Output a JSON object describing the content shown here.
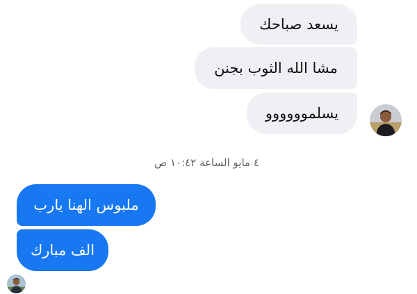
{
  "conversation": {
    "incoming": [
      {
        "text": "يسعد صباحك"
      },
      {
        "text": "مشا الله الثوب بجنن"
      },
      {
        "text": "يسلموووووو"
      }
    ],
    "timestamp": "٤ مايو الساعة ١٠:٤٢ ص",
    "outgoing": [
      {
        "text": "ملبوس الهنا يارب"
      },
      {
        "text": "الف مبارك"
      }
    ]
  },
  "avatars": {
    "contact": {
      "icon": "user-avatar-photo"
    },
    "self": {
      "icon": "user-avatar-photo"
    }
  },
  "colors": {
    "incoming_bubble": "#eef0f3",
    "outgoing_bubble": "#1778f2",
    "incoming_text": "#111111",
    "outgoing_text": "#ffffff",
    "timestamp_text": "#5b5d61"
  }
}
